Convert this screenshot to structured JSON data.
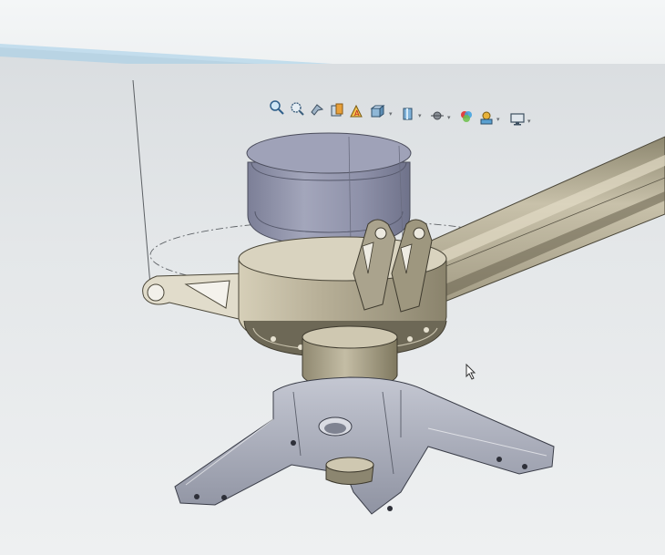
{
  "app": {
    "type": "3D CAD modeling viewport",
    "background_color": "#e6e9eb"
  },
  "heads_up_toolbar": {
    "buttons": [
      {
        "name": "zoom-to-fit",
        "icon": "zoom-fit-icon"
      },
      {
        "name": "zoom-to-area",
        "icon": "zoom-area-icon"
      },
      {
        "name": "previous-view",
        "icon": "previous-view-icon"
      },
      {
        "name": "section-view",
        "icon": "section-view-icon"
      },
      {
        "name": "dynamic-annotation-views",
        "icon": "annotation-view-icon"
      },
      {
        "name": "view-orientation",
        "icon": "view-orientation-icon"
      },
      {
        "name": "display-style",
        "icon": "display-style-icon"
      },
      {
        "name": "hide-show-items",
        "icon": "hide-show-icon"
      },
      {
        "name": "edit-appearance",
        "icon": "appearance-icon"
      },
      {
        "name": "apply-scene",
        "icon": "scene-icon"
      },
      {
        "name": "view-settings",
        "icon": "monitor-icon"
      }
    ]
  },
  "model": {
    "description_colors": {
      "motor_housing": "#8c8fa6",
      "frame_body": "#b5ae98",
      "base_mount": "#a5a9b6",
      "arm_tube": "#aba590"
    }
  }
}
